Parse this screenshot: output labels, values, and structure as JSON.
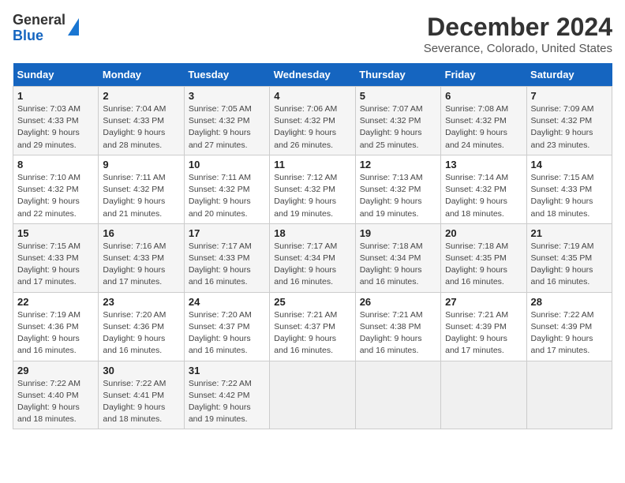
{
  "header": {
    "logo_line1": "General",
    "logo_line2": "Blue",
    "title": "December 2024",
    "subtitle": "Severance, Colorado, United States"
  },
  "days_of_week": [
    "Sunday",
    "Monday",
    "Tuesday",
    "Wednesday",
    "Thursday",
    "Friday",
    "Saturday"
  ],
  "weeks": [
    [
      {
        "day": 1,
        "sunrise": "7:03 AM",
        "sunset": "4:33 PM",
        "daylight": "9 hours and 29 minutes."
      },
      {
        "day": 2,
        "sunrise": "7:04 AM",
        "sunset": "4:33 PM",
        "daylight": "9 hours and 28 minutes."
      },
      {
        "day": 3,
        "sunrise": "7:05 AM",
        "sunset": "4:32 PM",
        "daylight": "9 hours and 27 minutes."
      },
      {
        "day": 4,
        "sunrise": "7:06 AM",
        "sunset": "4:32 PM",
        "daylight": "9 hours and 26 minutes."
      },
      {
        "day": 5,
        "sunrise": "7:07 AM",
        "sunset": "4:32 PM",
        "daylight": "9 hours and 25 minutes."
      },
      {
        "day": 6,
        "sunrise": "7:08 AM",
        "sunset": "4:32 PM",
        "daylight": "9 hours and 24 minutes."
      },
      {
        "day": 7,
        "sunrise": "7:09 AM",
        "sunset": "4:32 PM",
        "daylight": "9 hours and 23 minutes."
      }
    ],
    [
      {
        "day": 8,
        "sunrise": "7:10 AM",
        "sunset": "4:32 PM",
        "daylight": "9 hours and 22 minutes."
      },
      {
        "day": 9,
        "sunrise": "7:11 AM",
        "sunset": "4:32 PM",
        "daylight": "9 hours and 21 minutes."
      },
      {
        "day": 10,
        "sunrise": "7:11 AM",
        "sunset": "4:32 PM",
        "daylight": "9 hours and 20 minutes."
      },
      {
        "day": 11,
        "sunrise": "7:12 AM",
        "sunset": "4:32 PM",
        "daylight": "9 hours and 19 minutes."
      },
      {
        "day": 12,
        "sunrise": "7:13 AM",
        "sunset": "4:32 PM",
        "daylight": "9 hours and 19 minutes."
      },
      {
        "day": 13,
        "sunrise": "7:14 AM",
        "sunset": "4:32 PM",
        "daylight": "9 hours and 18 minutes."
      },
      {
        "day": 14,
        "sunrise": "7:15 AM",
        "sunset": "4:33 PM",
        "daylight": "9 hours and 18 minutes."
      }
    ],
    [
      {
        "day": 15,
        "sunrise": "7:15 AM",
        "sunset": "4:33 PM",
        "daylight": "9 hours and 17 minutes."
      },
      {
        "day": 16,
        "sunrise": "7:16 AM",
        "sunset": "4:33 PM",
        "daylight": "9 hours and 17 minutes."
      },
      {
        "day": 17,
        "sunrise": "7:17 AM",
        "sunset": "4:33 PM",
        "daylight": "9 hours and 16 minutes."
      },
      {
        "day": 18,
        "sunrise": "7:17 AM",
        "sunset": "4:34 PM",
        "daylight": "9 hours and 16 minutes."
      },
      {
        "day": 19,
        "sunrise": "7:18 AM",
        "sunset": "4:34 PM",
        "daylight": "9 hours and 16 minutes."
      },
      {
        "day": 20,
        "sunrise": "7:18 AM",
        "sunset": "4:35 PM",
        "daylight": "9 hours and 16 minutes."
      },
      {
        "day": 21,
        "sunrise": "7:19 AM",
        "sunset": "4:35 PM",
        "daylight": "9 hours and 16 minutes."
      }
    ],
    [
      {
        "day": 22,
        "sunrise": "7:19 AM",
        "sunset": "4:36 PM",
        "daylight": "9 hours and 16 minutes."
      },
      {
        "day": 23,
        "sunrise": "7:20 AM",
        "sunset": "4:36 PM",
        "daylight": "9 hours and 16 minutes."
      },
      {
        "day": 24,
        "sunrise": "7:20 AM",
        "sunset": "4:37 PM",
        "daylight": "9 hours and 16 minutes."
      },
      {
        "day": 25,
        "sunrise": "7:21 AM",
        "sunset": "4:37 PM",
        "daylight": "9 hours and 16 minutes."
      },
      {
        "day": 26,
        "sunrise": "7:21 AM",
        "sunset": "4:38 PM",
        "daylight": "9 hours and 16 minutes."
      },
      {
        "day": 27,
        "sunrise": "7:21 AM",
        "sunset": "4:39 PM",
        "daylight": "9 hours and 17 minutes."
      },
      {
        "day": 28,
        "sunrise": "7:22 AM",
        "sunset": "4:39 PM",
        "daylight": "9 hours and 17 minutes."
      }
    ],
    [
      {
        "day": 29,
        "sunrise": "7:22 AM",
        "sunset": "4:40 PM",
        "daylight": "9 hours and 18 minutes."
      },
      {
        "day": 30,
        "sunrise": "7:22 AM",
        "sunset": "4:41 PM",
        "daylight": "9 hours and 18 minutes."
      },
      {
        "day": 31,
        "sunrise": "7:22 AM",
        "sunset": "4:42 PM",
        "daylight": "9 hours and 19 minutes."
      },
      null,
      null,
      null,
      null
    ]
  ]
}
